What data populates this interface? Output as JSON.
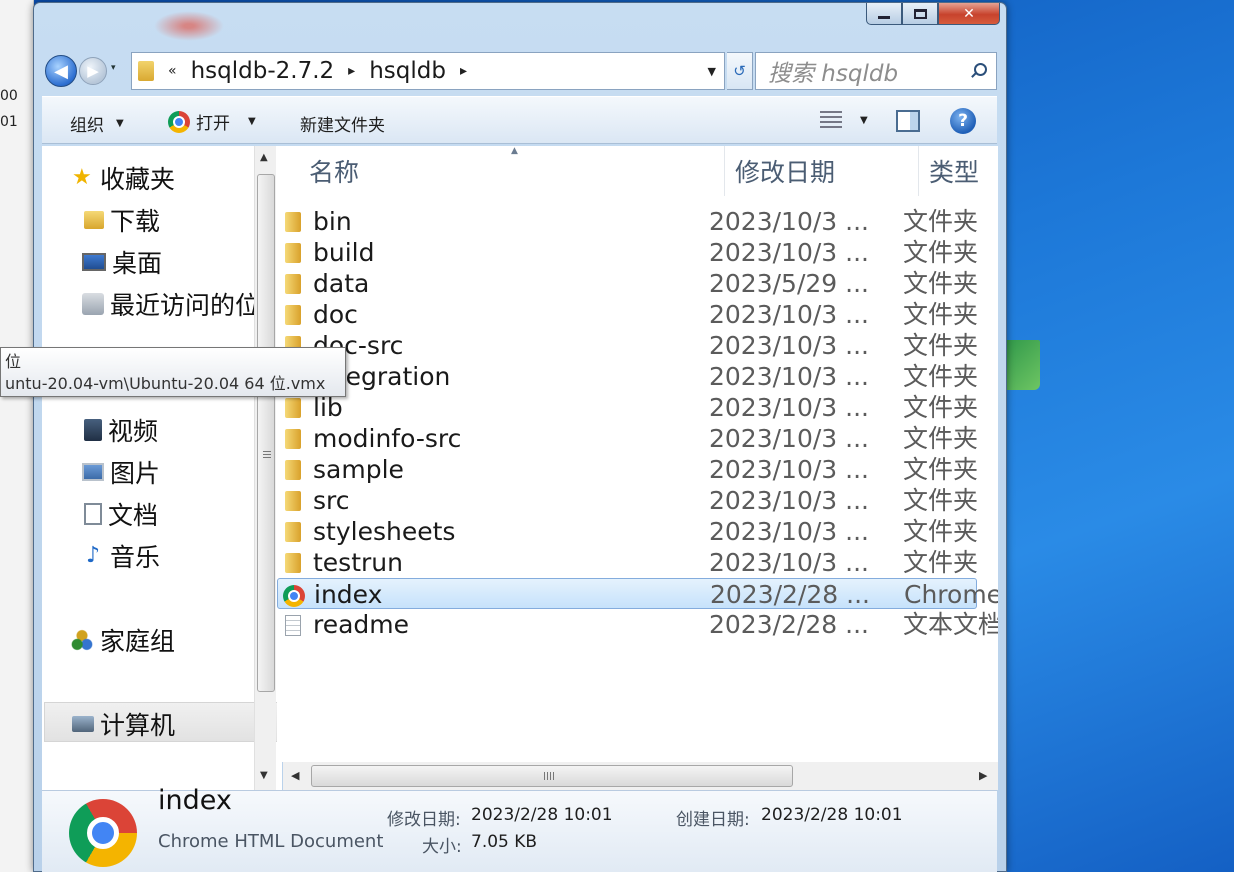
{
  "left_strip": {
    "fragments": [
      "00",
      "01"
    ]
  },
  "window": {
    "caption": {
      "minimize": "",
      "maximize": "",
      "close": "✕"
    }
  },
  "navbar": {
    "back_glyph": "◀",
    "forward_glyph": "▶",
    "dropdown_glyph": "▾",
    "overflow": "«",
    "breadcrumbs": [
      "hsqldb-2.7.2",
      "hsqldb"
    ],
    "separator": "▸",
    "address_dropdown": "▼",
    "refresh_glyph": "↺",
    "search_placeholder": "搜索 hsqldb"
  },
  "toolbar": {
    "organize": "组织",
    "open": "打开",
    "new_folder": "新建文件夹",
    "dropdown_glyph": "▼",
    "help": "?"
  },
  "navpane": {
    "favorites": "收藏夹",
    "downloads": "下载",
    "desktop": "桌面",
    "recent": "最近访问的位",
    "videos": "视频",
    "pictures": "图片",
    "documents": "文档",
    "music": "音乐",
    "homegroup": "家庭组",
    "computer": "计算机",
    "scroll_up": "▲",
    "scroll_down": "▼"
  },
  "tooltip": {
    "line1": "位",
    "line2": "untu-20.04-vm\\Ubuntu-20.04 64 位.vmx"
  },
  "columns": {
    "name": "名称",
    "modified": "修改日期",
    "type": "类型",
    "sort_glyph": "▲"
  },
  "files": [
    {
      "name": "bin",
      "date": "2023/10/3 ...",
      "type": "文件夹",
      "icon": "folder-icon"
    },
    {
      "name": "build",
      "date": "2023/10/3 ...",
      "type": "文件夹",
      "icon": "folder-icon"
    },
    {
      "name": "data",
      "date": "2023/5/29 ...",
      "type": "文件夹",
      "icon": "folder-icon"
    },
    {
      "name": "doc",
      "date": "2023/10/3 ...",
      "type": "文件夹",
      "icon": "folder-icon"
    },
    {
      "name": "doc-src",
      "date": "2023/10/3 ...",
      "type": "文件夹",
      "icon": "folder-icon"
    },
    {
      "name": "integration",
      "date": "2023/10/3 ...",
      "type": "文件夹",
      "icon": "folder-icon"
    },
    {
      "name": "lib",
      "date": "2023/10/3 ...",
      "type": "文件夹",
      "icon": "folder-icon"
    },
    {
      "name": "modinfo-src",
      "date": "2023/10/3 ...",
      "type": "文件夹",
      "icon": "folder-icon"
    },
    {
      "name": "sample",
      "date": "2023/10/3 ...",
      "type": "文件夹",
      "icon": "folder-icon"
    },
    {
      "name": "src",
      "date": "2023/10/3 ...",
      "type": "文件夹",
      "icon": "folder-icon"
    },
    {
      "name": "stylesheets",
      "date": "2023/10/3 ...",
      "type": "文件夹",
      "icon": "folder-icon"
    },
    {
      "name": "testrun",
      "date": "2023/10/3 ...",
      "type": "文件夹",
      "icon": "folder-icon"
    },
    {
      "name": "index",
      "date": "2023/2/28 ...",
      "type": "Chrome HTML Document",
      "icon": "chrome-icon",
      "selected": true
    },
    {
      "name": "readme",
      "date": "2023/2/28 ...",
      "type": "文本文档",
      "icon": "text-file-icon"
    }
  ],
  "hscroll": {
    "left": "◀",
    "right": "▶"
  },
  "details": {
    "name": "index",
    "kind": "Chrome HTML Document",
    "modified_label": "修改日期:",
    "modified_value": "2023/2/28 10:01",
    "created_label": "创建日期:",
    "created_value": "2023/2/28 10:01",
    "size_label": "大小:",
    "size_value": "7.05 KB"
  },
  "colors": {
    "desktop": "#1d78d8",
    "window_frame": "#c7ddf2",
    "selection": "#c6e2fb",
    "close_button": "#c7432d"
  }
}
